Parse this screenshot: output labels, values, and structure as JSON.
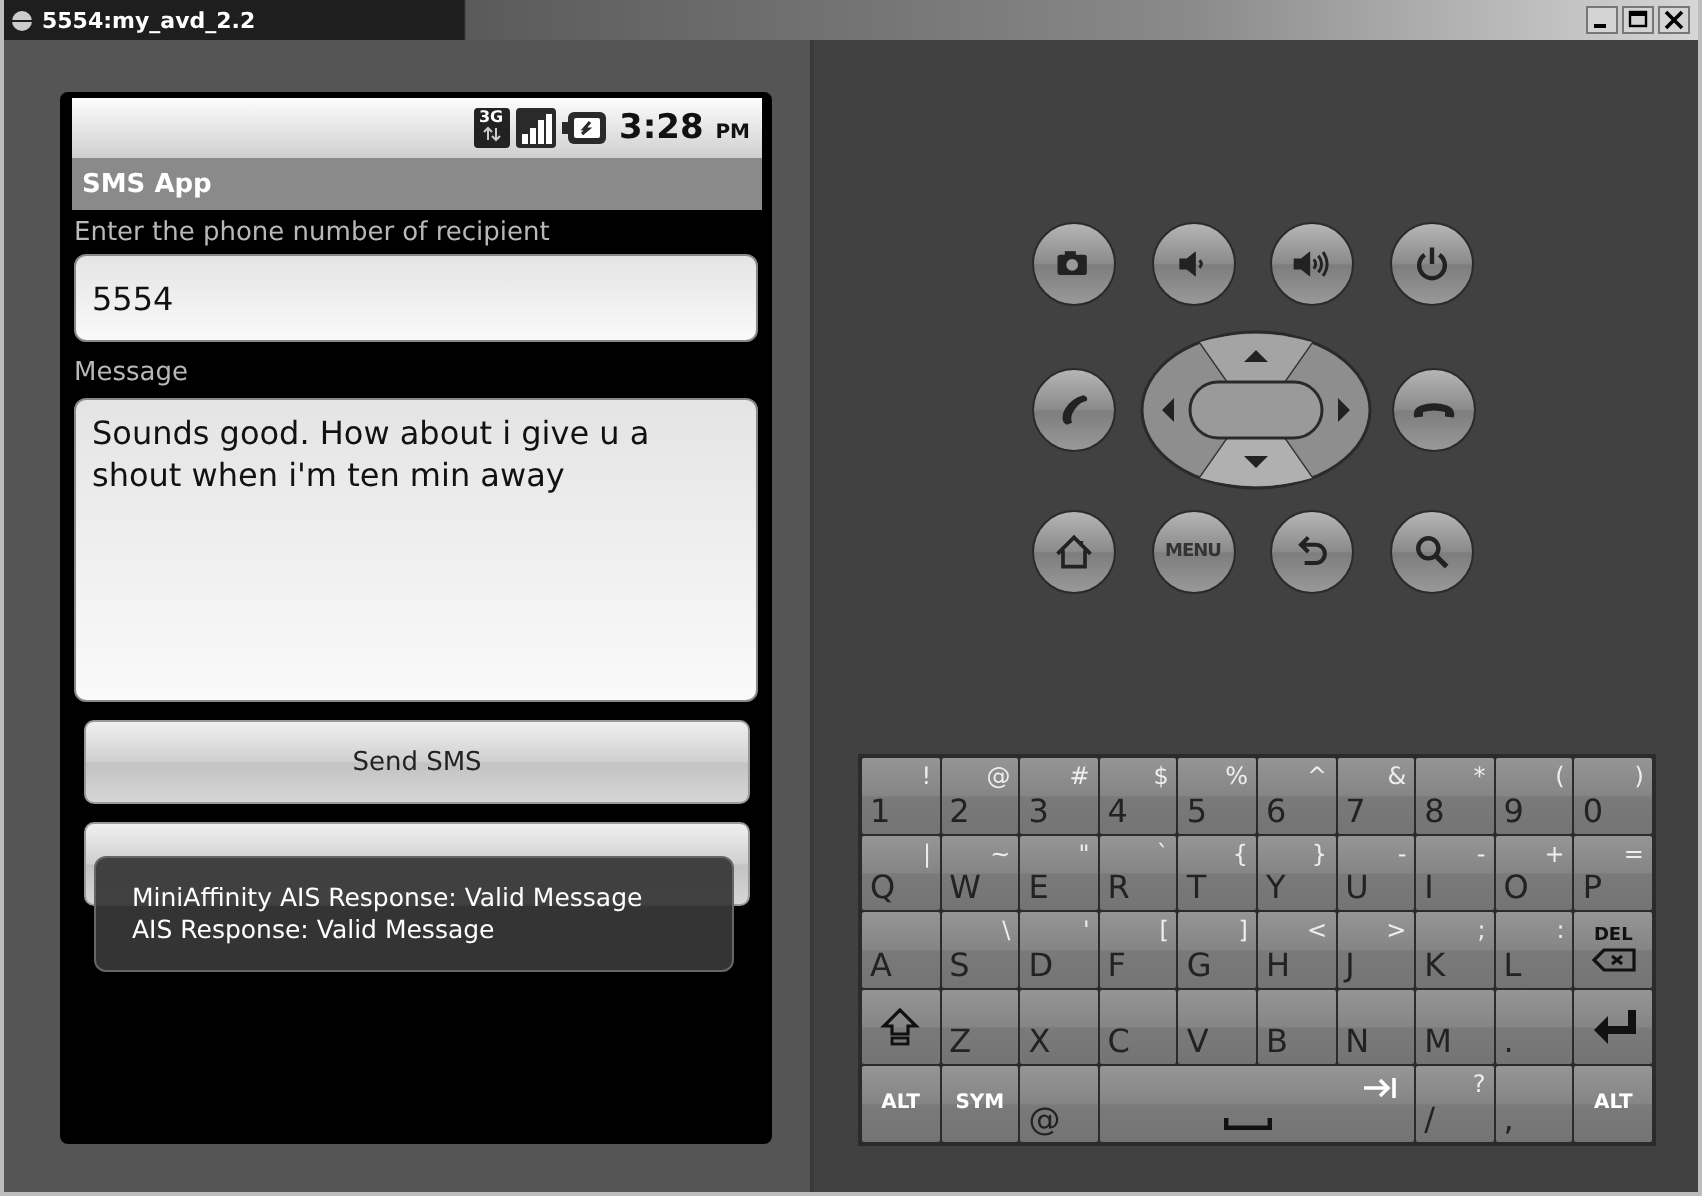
{
  "window": {
    "title": "5554:my_avd_2.2"
  },
  "status_bar": {
    "network": "3G",
    "time": "3:28",
    "ampm": "PM"
  },
  "app_bar": {
    "title": "SMS App"
  },
  "form": {
    "phone_label": "Enter the phone number of recipient",
    "phone_value": "5554",
    "message_label": "Message",
    "message_value": "Sounds good. How about i give u a shout when i'm ten min away",
    "buttons": [
      {
        "kind": "labeled",
        "label": "Send SMS"
      },
      {
        "kind": "blank"
      }
    ]
  },
  "toast": {
    "lines": [
      "MiniAffinity AIS Response: Valid Message",
      "AIS Response: Valid Message"
    ]
  },
  "hardware_buttons": [
    [
      {
        "kind": "camera"
      },
      {
        "kind": "volume-down"
      },
      {
        "kind": "volume-up"
      },
      {
        "kind": "power"
      }
    ],
    [
      {
        "kind": "call"
      },
      {
        "kind": "dpad"
      },
      {
        "kind": "end-call"
      }
    ],
    [
      {
        "kind": "home"
      },
      {
        "kind": "menu",
        "label": "MENU"
      },
      {
        "kind": "back"
      },
      {
        "kind": "search"
      }
    ]
  ],
  "keyboard": [
    [
      {
        "kind": "char",
        "main": "1",
        "alt": "!"
      },
      {
        "kind": "char",
        "main": "2",
        "alt": "@"
      },
      {
        "kind": "char",
        "main": "3",
        "alt": "#"
      },
      {
        "kind": "char",
        "main": "4",
        "alt": "$"
      },
      {
        "kind": "char",
        "main": "5",
        "alt": "%"
      },
      {
        "kind": "char",
        "main": "6",
        "alt": "^"
      },
      {
        "kind": "char",
        "main": "7",
        "alt": "&"
      },
      {
        "kind": "char",
        "main": "8",
        "alt": "*"
      },
      {
        "kind": "char",
        "main": "9",
        "alt": "("
      },
      {
        "kind": "char",
        "main": "0",
        "alt": ")"
      }
    ],
    [
      {
        "kind": "char",
        "main": "Q",
        "alt": "|"
      },
      {
        "kind": "char",
        "main": "W",
        "alt": "~"
      },
      {
        "kind": "char",
        "main": "E",
        "alt": "\""
      },
      {
        "kind": "char",
        "main": "R",
        "alt": "`"
      },
      {
        "kind": "char",
        "main": "T",
        "alt": "{"
      },
      {
        "kind": "char",
        "main": "Y",
        "alt": "}"
      },
      {
        "kind": "char",
        "main": "U",
        "alt": "-"
      },
      {
        "kind": "char",
        "main": "I",
        "alt": "-"
      },
      {
        "kind": "char",
        "main": "O",
        "alt": "+"
      },
      {
        "kind": "char",
        "main": "P",
        "alt": "="
      }
    ],
    [
      {
        "kind": "char",
        "main": "A"
      },
      {
        "kind": "char",
        "main": "S",
        "alt": "\\"
      },
      {
        "kind": "char",
        "main": "D",
        "alt": "'"
      },
      {
        "kind": "char",
        "main": "F",
        "alt": "["
      },
      {
        "kind": "char",
        "main": "G",
        "alt": "]"
      },
      {
        "kind": "char",
        "main": "H",
        "alt": "<"
      },
      {
        "kind": "char",
        "main": "J",
        "alt": ">"
      },
      {
        "kind": "char",
        "main": "K",
        "alt": ";"
      },
      {
        "kind": "char",
        "main": "L",
        "alt": ":"
      },
      {
        "kind": "del",
        "main": "DEL"
      }
    ],
    [
      {
        "kind": "shift"
      },
      {
        "kind": "char",
        "main": "Z"
      },
      {
        "kind": "char",
        "main": "X"
      },
      {
        "kind": "char",
        "main": "C"
      },
      {
        "kind": "char",
        "main": "V"
      },
      {
        "kind": "char",
        "main": "B"
      },
      {
        "kind": "char",
        "main": "N"
      },
      {
        "kind": "char",
        "main": "M"
      },
      {
        "kind": "char",
        "main": "."
      },
      {
        "kind": "enter"
      }
    ],
    [
      {
        "kind": "mod",
        "main": "ALT"
      },
      {
        "kind": "mod",
        "main": "SYM"
      },
      {
        "kind": "char",
        "main": "@"
      },
      {
        "kind": "space"
      },
      {
        "kind": "char",
        "main": "/",
        "alt": "?"
      },
      {
        "kind": "char",
        "main": ","
      },
      {
        "kind": "mod",
        "main": "ALT"
      }
    ]
  ]
}
